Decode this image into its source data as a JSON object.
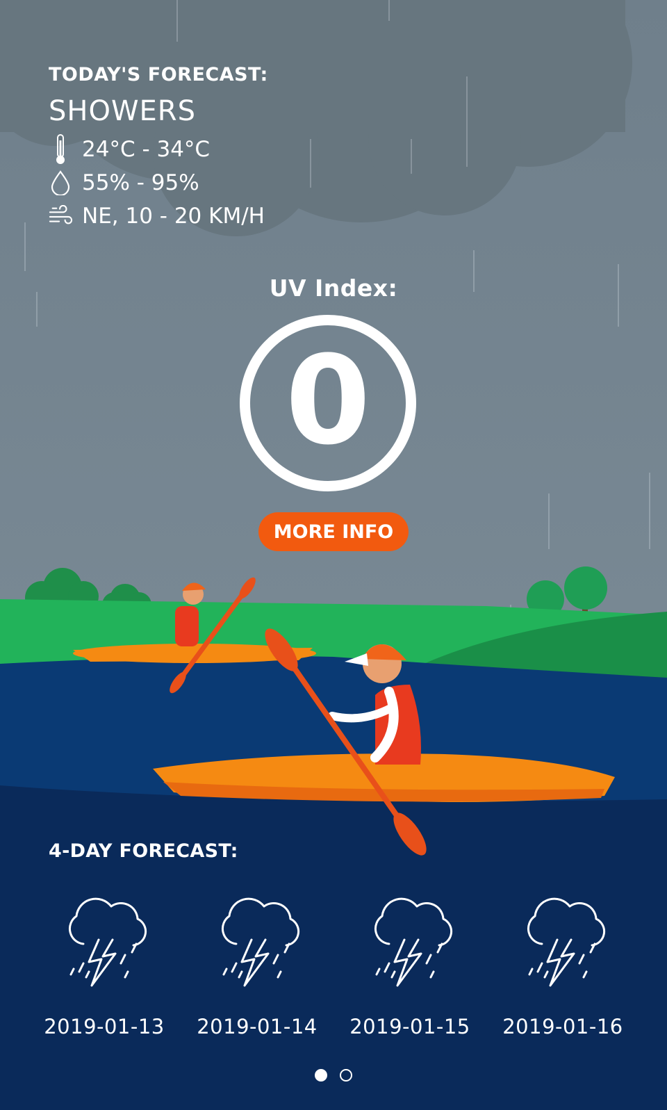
{
  "today": {
    "label": "TODAY'S FORECAST:",
    "condition": "SHOWERS",
    "temperature": "24°C - 34°C",
    "humidity": "55% - 95%",
    "wind": "NE, 10 - 20 KM/H",
    "icons": [
      "thermometer-icon",
      "droplet-icon",
      "wind-icon"
    ]
  },
  "uv": {
    "label": "UV Index:",
    "value": "0",
    "button": "MORE INFO"
  },
  "forecast": {
    "label": "4-DAY FORECAST:",
    "days": [
      {
        "date": "2019-01-13",
        "icon": "thunderstorm-icon"
      },
      {
        "date": "2019-01-14",
        "icon": "thunderstorm-icon"
      },
      {
        "date": "2019-01-15",
        "icon": "thunderstorm-icon"
      },
      {
        "date": "2019-01-16",
        "icon": "thunderstorm-icon"
      }
    ]
  },
  "pagination": {
    "pages": 2,
    "active": 1
  },
  "colors": {
    "sky": "#7a8a96",
    "cloud": "#6a7a86",
    "grass": "#1f9e55",
    "river": "#0a3a74",
    "deep_water": "#0a2a5a",
    "kayak": "#f58a12",
    "button": "#f25a0f"
  }
}
